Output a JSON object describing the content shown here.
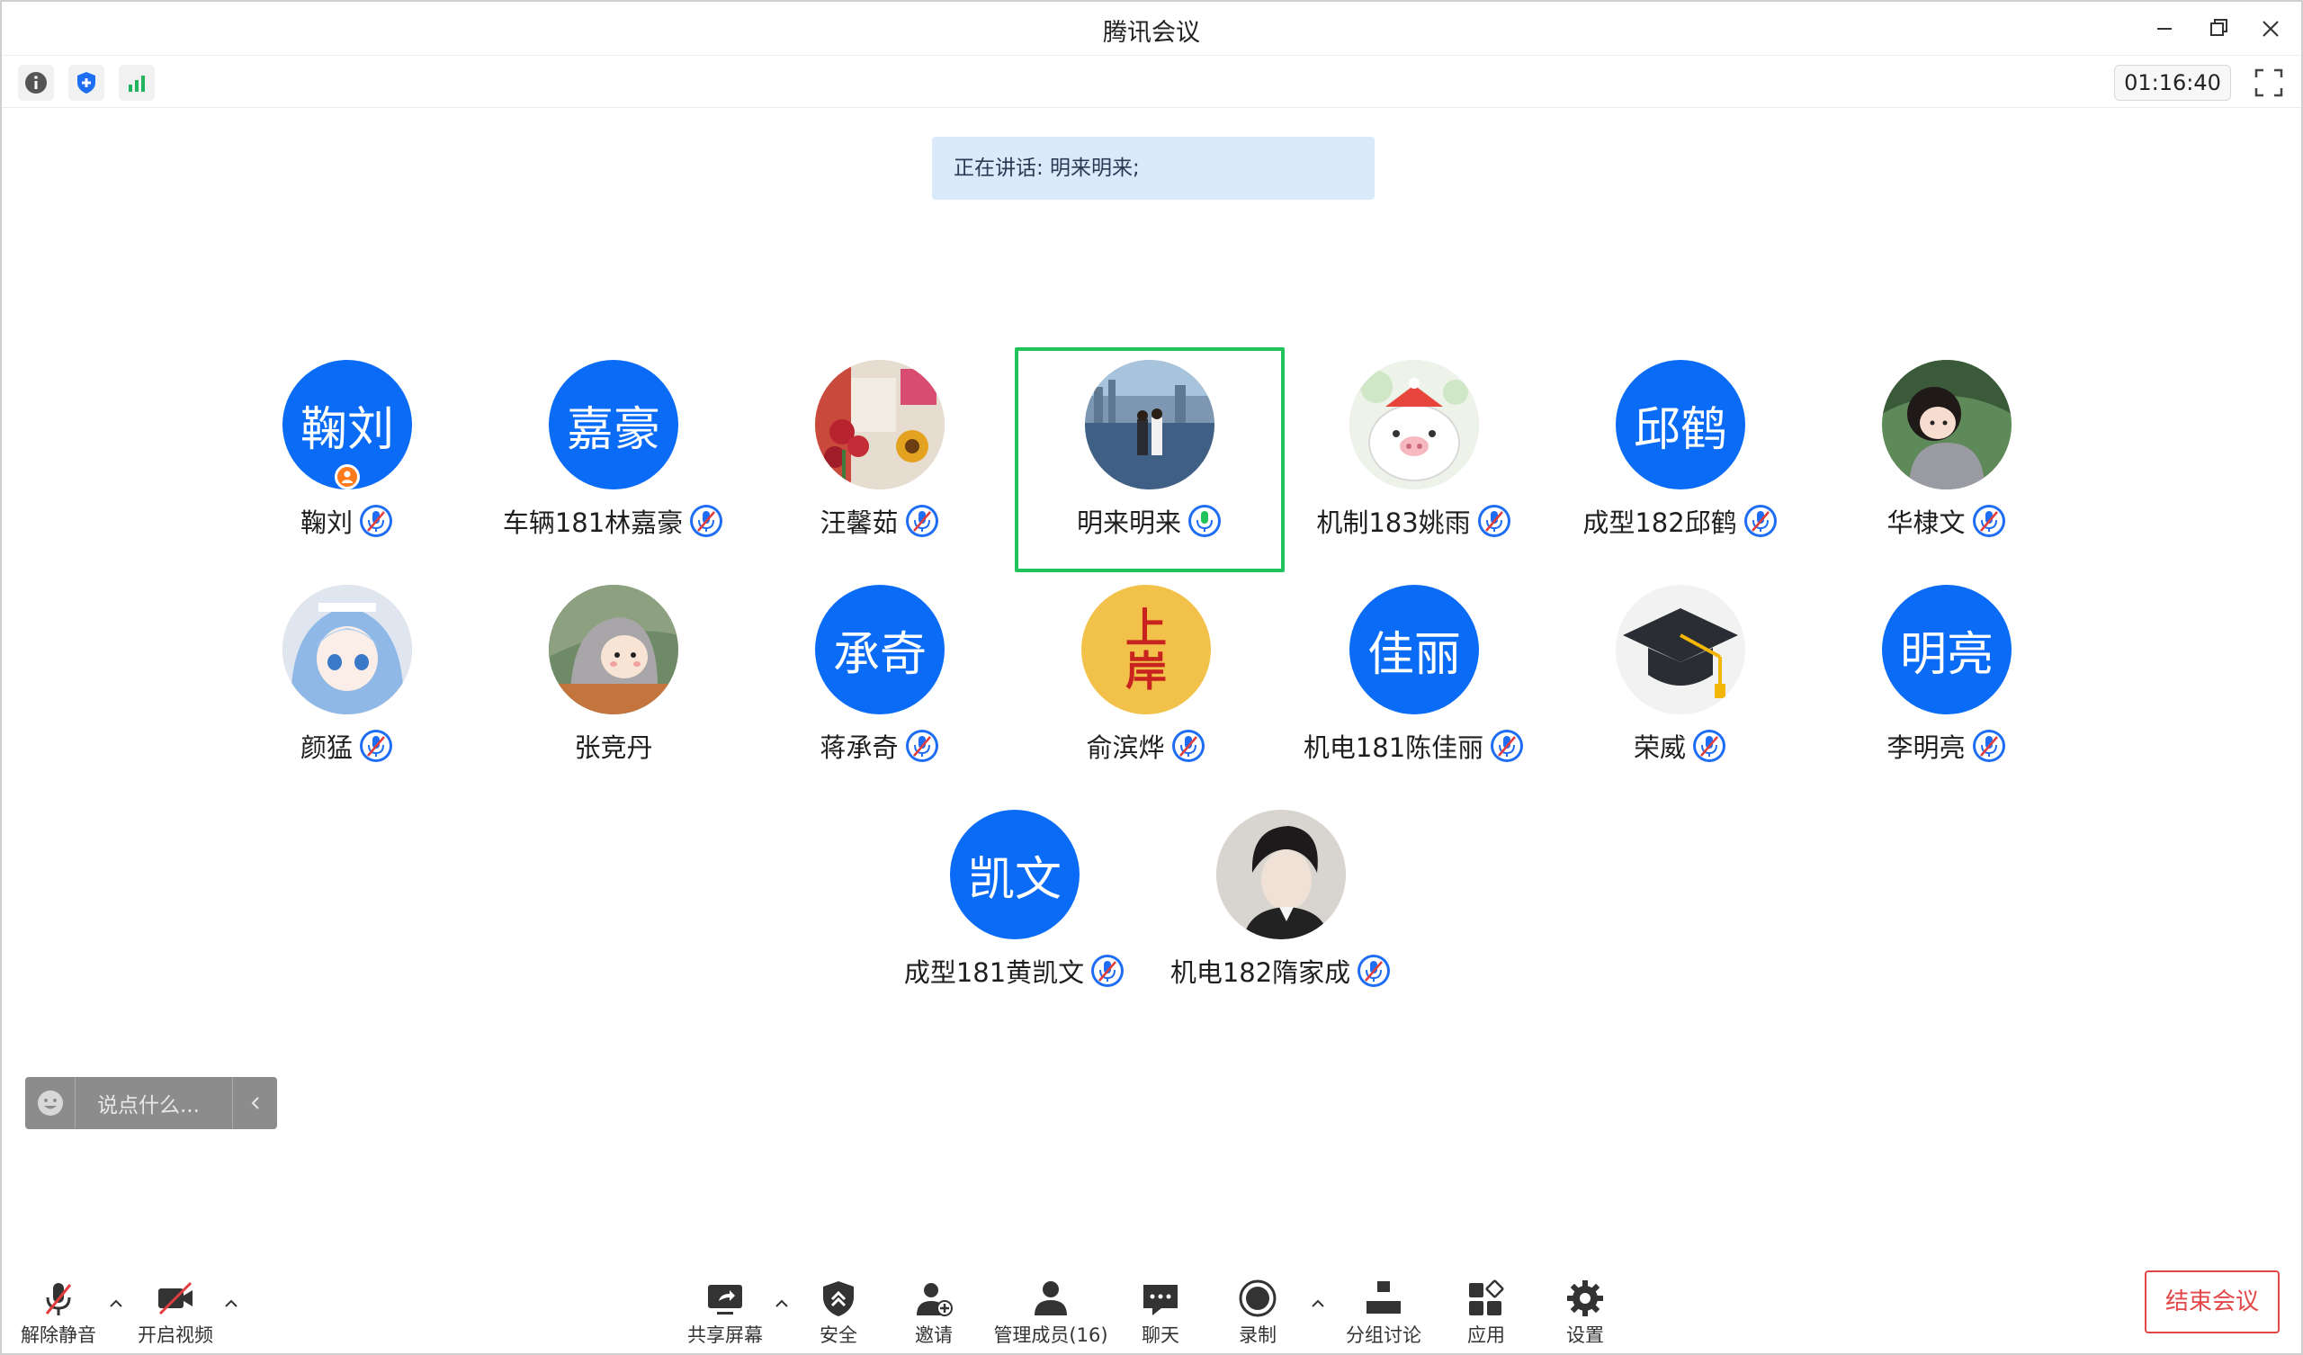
{
  "window": {
    "title": "腾讯会议",
    "timer": "01:16:40"
  },
  "speaking_banner": "正在讲话: 明来明来;",
  "participants": [
    {
      "avatar_text": "鞠刘",
      "name": "鞠刘",
      "avatar": "text",
      "host": true
    },
    {
      "avatar_text": "嘉豪",
      "name": "车辆181林嘉豪",
      "avatar": "text"
    },
    {
      "avatar_text": "",
      "name": "汪馨茹",
      "avatar": "photo-flowers"
    },
    {
      "avatar_text": "",
      "name": "明来明来",
      "avatar": "photo-couple",
      "speaking": true
    },
    {
      "avatar_text": "",
      "name": "机制183姚雨",
      "avatar": "photo-pig"
    },
    {
      "avatar_text": "邱鹤",
      "name": "成型182邱鹤",
      "avatar": "text"
    },
    {
      "avatar_text": "",
      "name": "华棣文",
      "avatar": "photo-girl"
    },
    {
      "avatar_text": "",
      "name": "颜猛",
      "avatar": "photo-anime"
    },
    {
      "avatar_text": "",
      "name": "张竞丹",
      "avatar": "photo-hoodie"
    },
    {
      "avatar_text": "承奇",
      "name": "蒋承奇",
      "avatar": "text"
    },
    {
      "avatar_text": "上岸",
      "name": "俞滨烨",
      "avatar": "photo-shangan"
    },
    {
      "avatar_text": "佳丽",
      "name": "机电181陈佳丽",
      "avatar": "text"
    },
    {
      "avatar_text": "",
      "name": "荣威",
      "avatar": "photo-gradcap"
    },
    {
      "avatar_text": "明亮",
      "name": "李明亮",
      "avatar": "text"
    },
    {
      "avatar_text": "凯文",
      "name": "成型181黄凯文",
      "avatar": "text"
    },
    {
      "avatar_text": "",
      "name": "机电182隋家成",
      "avatar": "photo-man"
    }
  ],
  "chat": {
    "placeholder": "说点什么..."
  },
  "toolbar": {
    "unmute": "解除静音",
    "start_video": "开启视频",
    "share_screen": "共享屏幕",
    "security": "安全",
    "invite": "邀请",
    "manage_members": "管理成员(16)",
    "chat": "聊天",
    "record": "录制",
    "breakout": "分组讨论",
    "apps": "应用",
    "settings": "设置",
    "end_meeting": "结束会议"
  },
  "colors": {
    "avatar_blue": "#0a6cf6",
    "speaking_border": "#20c45a",
    "end_red": "#e34646",
    "banner_bg": "#dbeafb"
  }
}
